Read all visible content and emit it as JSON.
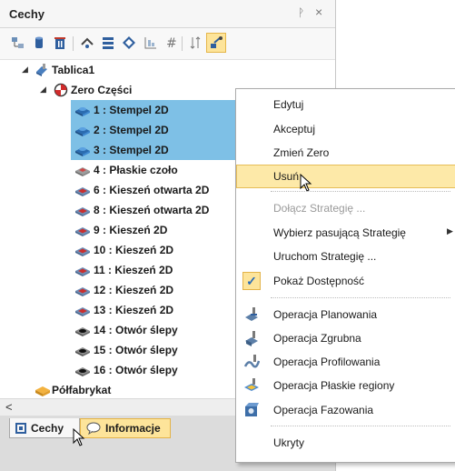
{
  "panel": {
    "title": "Cechy",
    "pin_glyph": "ᚹ",
    "close_glyph": "×",
    "toolbar_icons": [
      "feature-tree-icon",
      "cylinder-icon",
      "delete-icon",
      "strategy-icon",
      "stack-icon",
      "diamond-icon",
      "grid-icon",
      "hash-icon",
      "sort-icon",
      "settings-active-icon"
    ]
  },
  "tree": {
    "root": {
      "label": "Tablica1",
      "icon": "stock-part-icon"
    },
    "zero": {
      "label": "Zero Części",
      "icon": "origin-icon"
    },
    "features": [
      {
        "label": "1 : Stempel 2D",
        "icon": "blue-boss-icon",
        "selected": true
      },
      {
        "label": "2 : Stempel 2D",
        "icon": "blue-boss-icon",
        "selected": true
      },
      {
        "label": "3 : Stempel 2D",
        "icon": "blue-boss-icon",
        "selected": true
      },
      {
        "label": "4 : Płaskie czoło",
        "icon": "flat-face-icon",
        "selected": false
      },
      {
        "label": "6 : Kieszeń otwarta 2D",
        "icon": "red-pocket-icon",
        "selected": false
      },
      {
        "label": "8 : Kieszeń otwarta 2D",
        "icon": "red-pocket-icon",
        "selected": false
      },
      {
        "label": "9 : Kieszeń 2D",
        "icon": "red-pocket-icon",
        "selected": false
      },
      {
        "label": "10 : Kieszeń 2D",
        "icon": "red-pocket-icon",
        "selected": false
      },
      {
        "label": "11 : Kieszeń 2D",
        "icon": "red-pocket-icon",
        "selected": false
      },
      {
        "label": "12 : Kieszeń 2D",
        "icon": "red-pocket-icon",
        "selected": false
      },
      {
        "label": "13 : Kieszeń 2D",
        "icon": "red-pocket-icon",
        "selected": false
      },
      {
        "label": "14 : Otwór ślepy",
        "icon": "blind-hole-icon",
        "selected": false
      },
      {
        "label": "15 : Otwór ślepy",
        "icon": "blind-hole-icon",
        "selected": false
      },
      {
        "label": "16 : Otwór ślepy",
        "icon": "blind-hole-icon",
        "selected": false
      }
    ],
    "blank": {
      "label": "Półfabrykat",
      "icon": "blank-stock-icon"
    }
  },
  "scroll": {
    "left_arrow": "<"
  },
  "tabs": [
    {
      "label": "Cechy",
      "icon": "features-tab-icon",
      "active": false
    },
    {
      "label": "Informacje",
      "icon": "info-bubble-icon",
      "active": true
    }
  ],
  "context_menu": {
    "items": [
      {
        "label": "Edytuj"
      },
      {
        "label": "Akceptuj"
      },
      {
        "label": "Zmień Zero"
      },
      {
        "label": "Usuń",
        "hovered": true
      },
      {
        "label": "Dołącz Strategię ...",
        "disabled": true
      },
      {
        "label": "Wybierz pasującą Strategię",
        "submenu": true
      },
      {
        "label": "Uruchom Strategię ..."
      },
      {
        "label": "Pokaż Dostępność",
        "checked": true
      },
      {
        "label": "Operacja Planowania",
        "icon": "facing-op-icon"
      },
      {
        "label": "Operacja Zgrubna",
        "icon": "roughing-op-icon"
      },
      {
        "label": "Operacja Profilowania",
        "icon": "profiling-op-icon"
      },
      {
        "label": "Operacja Płaskie regiony",
        "icon": "flat-regions-op-icon"
      },
      {
        "label": "Operacja Fazowania",
        "icon": "chamfer-op-icon"
      },
      {
        "label": "Ukryty"
      }
    ],
    "submenu_glyph": "▶",
    "check_glyph": "✓"
  },
  "colors": {
    "selection": "#7ec0e6",
    "hover": "#fde9a8",
    "accent_border": "#e3b34a"
  }
}
